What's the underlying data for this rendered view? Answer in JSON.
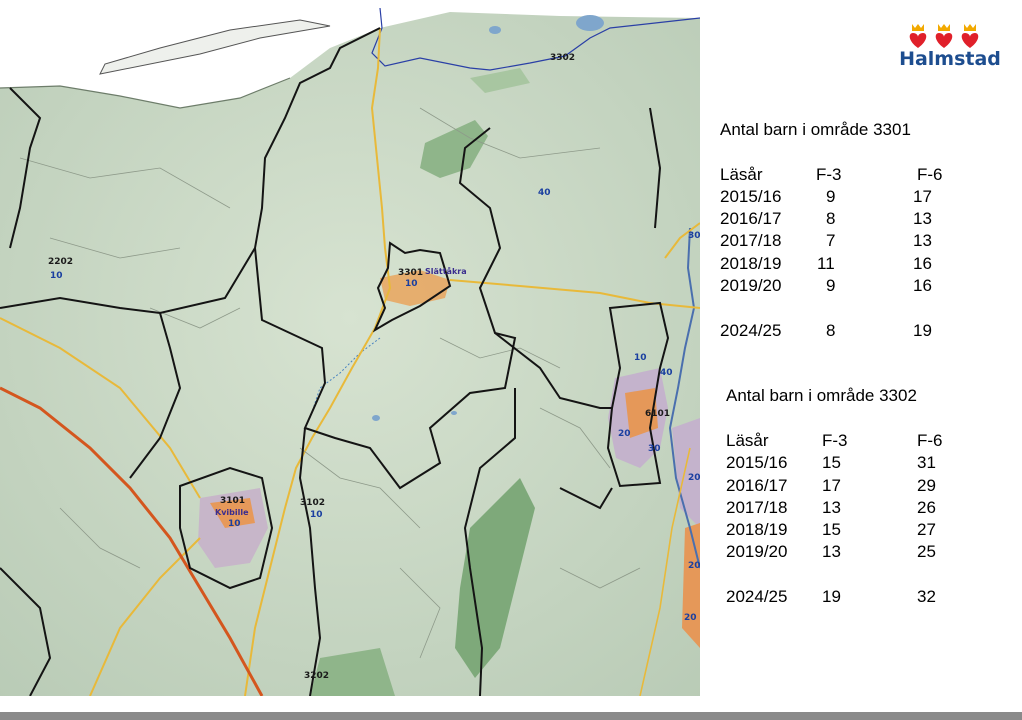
{
  "logo": {
    "text": "Halmstad",
    "icon": "three-crowned-hearts-icon",
    "heart_color": "#e0202a",
    "crown_color": "#f2a900"
  },
  "map": {
    "areas": [
      {
        "code": "3302",
        "sub": ""
      },
      {
        "code": "2202",
        "sub": "10"
      },
      {
        "code": "3301",
        "sub": "10",
        "place": "Slättåkra"
      },
      {
        "code": "6101",
        "sub": ""
      },
      {
        "code": "3101",
        "sub": "10",
        "place": "Kvibille"
      },
      {
        "code": "3102",
        "sub": "10"
      },
      {
        "code": "3202",
        "sub": ""
      }
    ],
    "road_numbers": [
      "40",
      "30",
      "10",
      "40",
      "20",
      "30",
      "20",
      "20",
      "20"
    ]
  },
  "tables": [
    {
      "title": "Antal barn i område 3301",
      "headers": [
        "Läsår",
        "F-3",
        "F-6"
      ],
      "rows": [
        [
          "2015/16",
          "9",
          "17"
        ],
        [
          "2016/17",
          "8",
          "13"
        ],
        [
          "2017/18",
          "7",
          "13"
        ],
        [
          "2018/19",
          "11",
          "16"
        ],
        [
          "2019/20",
          "9",
          "16"
        ]
      ],
      "forecast": [
        "2024/25",
        "8",
        "19"
      ]
    },
    {
      "title": "Antal barn i område 3302",
      "headers": [
        "Läsår",
        "F-3",
        "F-6"
      ],
      "rows": [
        [
          "2015/16",
          "15",
          "31"
        ],
        [
          "2016/17",
          "17",
          "29"
        ],
        [
          "2017/18",
          "13",
          "26"
        ],
        [
          "2018/19",
          "15",
          "27"
        ],
        [
          "2019/20",
          "13",
          "25"
        ]
      ],
      "forecast": [
        "2024/25",
        "19",
        "32"
      ]
    }
  ]
}
